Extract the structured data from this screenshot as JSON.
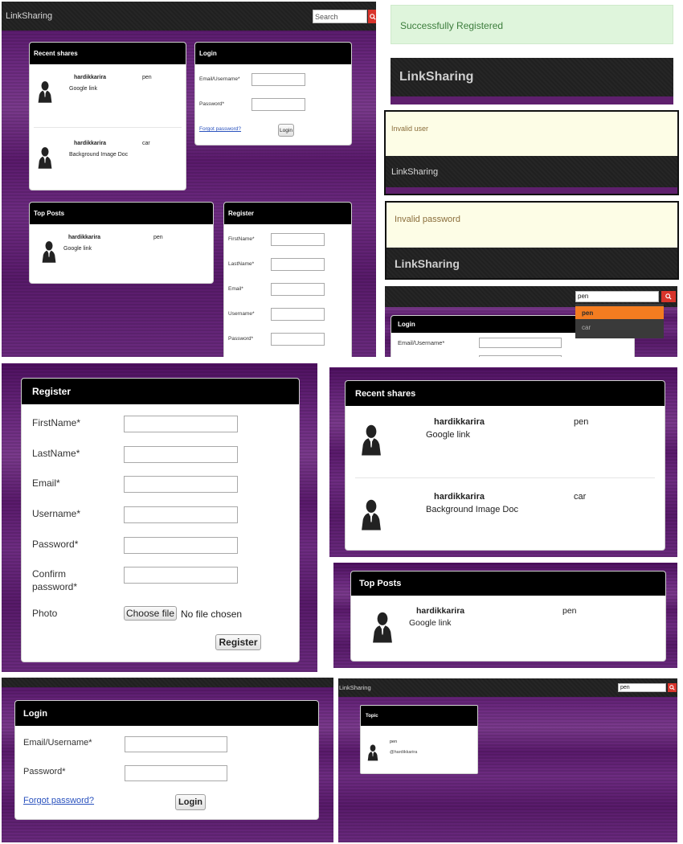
{
  "brand": "LinkSharing",
  "search": {
    "placeholder": "Search",
    "query": "pen",
    "suggestions": [
      "pen",
      "car"
    ]
  },
  "recent_shares": {
    "title": "Recent shares",
    "items": [
      {
        "user": "hardikkarira",
        "topic": "pen",
        "resource": "Google link"
      },
      {
        "user": "hardikkarira",
        "topic": "car",
        "resource": "Background Image Doc"
      }
    ]
  },
  "top_posts": {
    "title": "Top Posts",
    "items": [
      {
        "user": "hardikkarira",
        "topic": "pen",
        "resource": "Google link"
      }
    ]
  },
  "login": {
    "title": "Login",
    "email_label": "Email/Username*",
    "password_label": "Password*",
    "forgot": "Forgot password?",
    "button": "Login"
  },
  "register": {
    "title": "Register",
    "firstname_label": "FirstName*",
    "lastname_label": "LastName*",
    "email_label": "Email*",
    "username_label": "Username*",
    "password_label": "Password*",
    "confirm_label_1": "Confirm",
    "confirm_label_2": "password*",
    "photo_label": "Photo",
    "choose_file": "Choose file",
    "no_file": "No file chosen",
    "button": "Register"
  },
  "alerts": {
    "success": "Successfully Registered",
    "invalid_user": "Invalid user",
    "invalid_password": "Invalid password"
  },
  "topic": {
    "title": "Topic",
    "name": "pen",
    "owner": "@hardikkarira"
  },
  "colors": {
    "purple": "#5e1f6d",
    "header": "#222222",
    "search_button": "#d9342b",
    "suggestion_highlight": "#f47c20",
    "link": "#2a52be",
    "success_bg": "#dff5dc",
    "warning_bg": "#fdfde6"
  }
}
